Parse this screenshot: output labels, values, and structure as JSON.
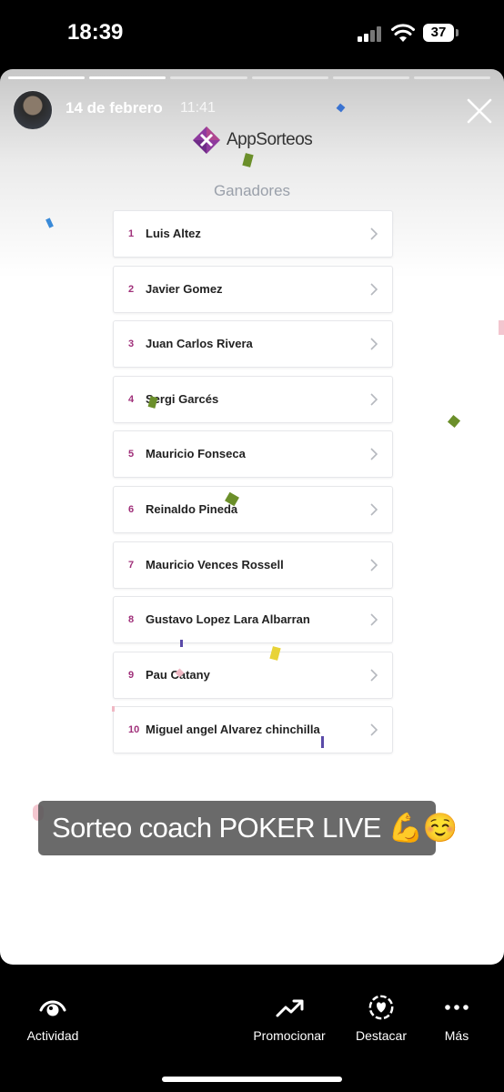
{
  "status_bar": {
    "time": "18:39",
    "battery": "37"
  },
  "story": {
    "date": "14 de febrero",
    "time": "11:41",
    "progress_total": 6,
    "progress_done": 2
  },
  "content": {
    "logo_text": "AppSorteos",
    "section_title": "Ganadores",
    "winners": [
      {
        "rank": "1",
        "name": "Luis Altez"
      },
      {
        "rank": "2",
        "name": "Javier Gomez"
      },
      {
        "rank": "3",
        "name": "Juan Carlos Rivera"
      },
      {
        "rank": "4",
        "name": "Sergi Garcés"
      },
      {
        "rank": "5",
        "name": "Mauricio Fonseca"
      },
      {
        "rank": "6",
        "name": "Reinaldo Pineda"
      },
      {
        "rank": "7",
        "name": "Mauricio Vences Rossell"
      },
      {
        "rank": "8",
        "name": "Gustavo Lopez Lara Albarran"
      },
      {
        "rank": "9",
        "name": "Pau Catany"
      },
      {
        "rank": "10",
        "name": "Miguel angel Alvarez chinchilla"
      }
    ]
  },
  "caption": "Sorteo coach POKER LIVE 💪☺️",
  "actions": {
    "activity": "Actividad",
    "promote": "Promocionar",
    "highlight": "Destacar",
    "more": "Más"
  },
  "colors": {
    "accent": "#a0307a",
    "logo_purple": "#8e3a9e"
  }
}
